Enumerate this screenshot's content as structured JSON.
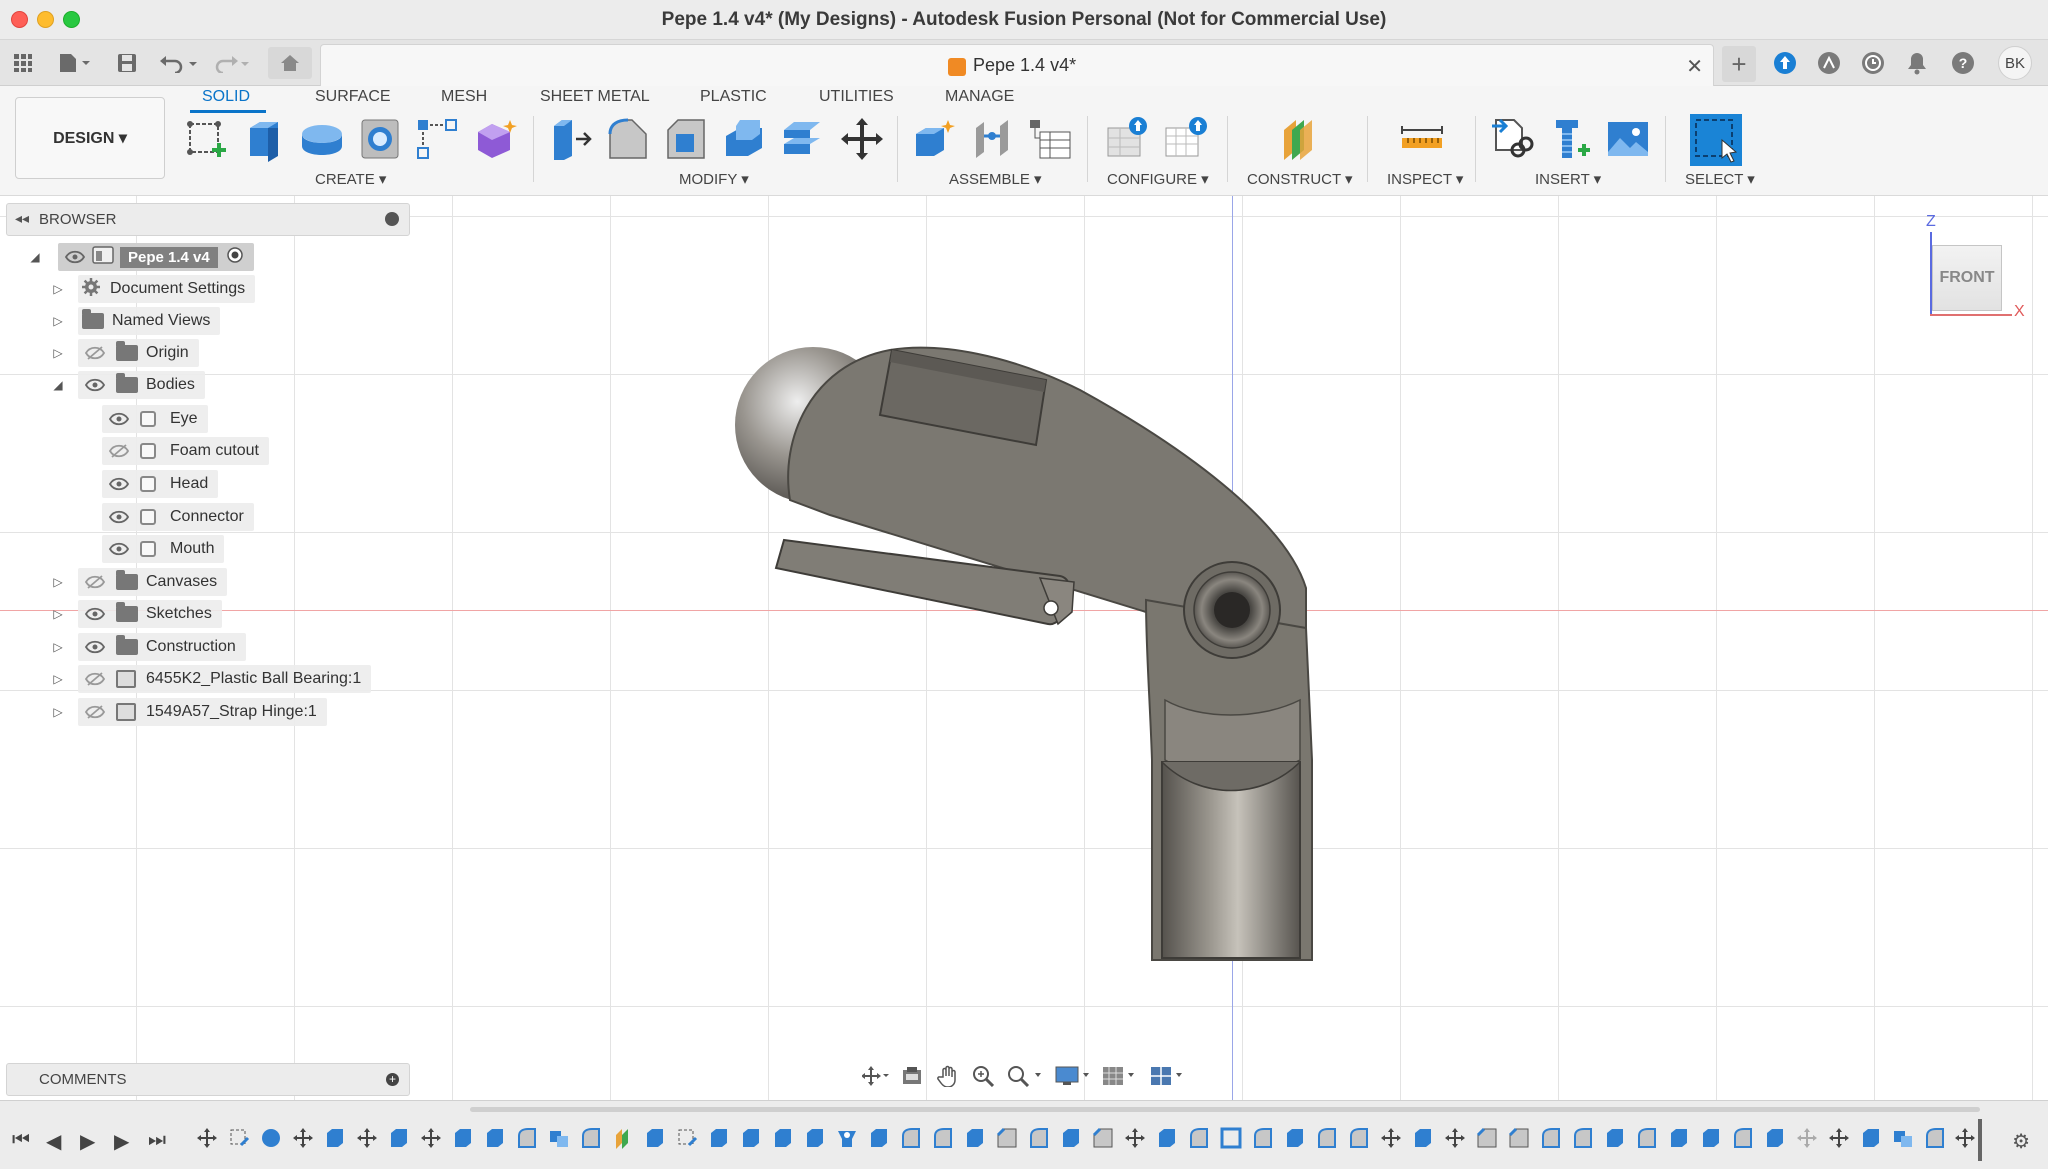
{
  "window": {
    "title": "Pepe 1.4 v4* (My Designs) - Autodesk Fusion Personal (Not for Commercial Use)"
  },
  "doc_tab": {
    "label": "Pepe 1.4 v4*"
  },
  "user": {
    "initials": "BK"
  },
  "workspace": {
    "label": "DESIGN ▾"
  },
  "toolbar_tabs": [
    "SOLID",
    "SURFACE",
    "MESH",
    "SHEET METAL",
    "PLASTIC",
    "UTILITIES",
    "MANAGE"
  ],
  "toolbar_groups": {
    "create": "CREATE ▾",
    "modify": "MODIFY ▾",
    "assemble": "ASSEMBLE ▾",
    "configure": "CONFIGURE ▾",
    "construct": "CONSTRUCT ▾",
    "inspect": "INSPECT ▾",
    "insert": "INSERT ▾",
    "select": "SELECT ▾"
  },
  "browser": {
    "title": "BROWSER",
    "root": "Pepe 1.4 v4",
    "items": [
      {
        "label": "Document Settings"
      },
      {
        "label": "Named Views"
      },
      {
        "label": "Origin"
      },
      {
        "label": "Bodies"
      },
      {
        "label": "Eye"
      },
      {
        "label": "Foam cutout"
      },
      {
        "label": "Head"
      },
      {
        "label": "Connector"
      },
      {
        "label": "Mouth"
      },
      {
        "label": "Canvases"
      },
      {
        "label": "Sketches"
      },
      {
        "label": "Construction"
      },
      {
        "label": "6455K2_Plastic Ball Bearing:1"
      },
      {
        "label": "1549A57_Strap Hinge:1"
      }
    ]
  },
  "viewcube": {
    "face": "FRONT",
    "z_label": "Z",
    "x_label": "X"
  },
  "comments": {
    "title": "COMMENTS"
  },
  "colors": {
    "accent": "#0a74c9",
    "model": "#7a7770",
    "axis_x": "#e07070",
    "axis_z": "#5a6ae0"
  }
}
